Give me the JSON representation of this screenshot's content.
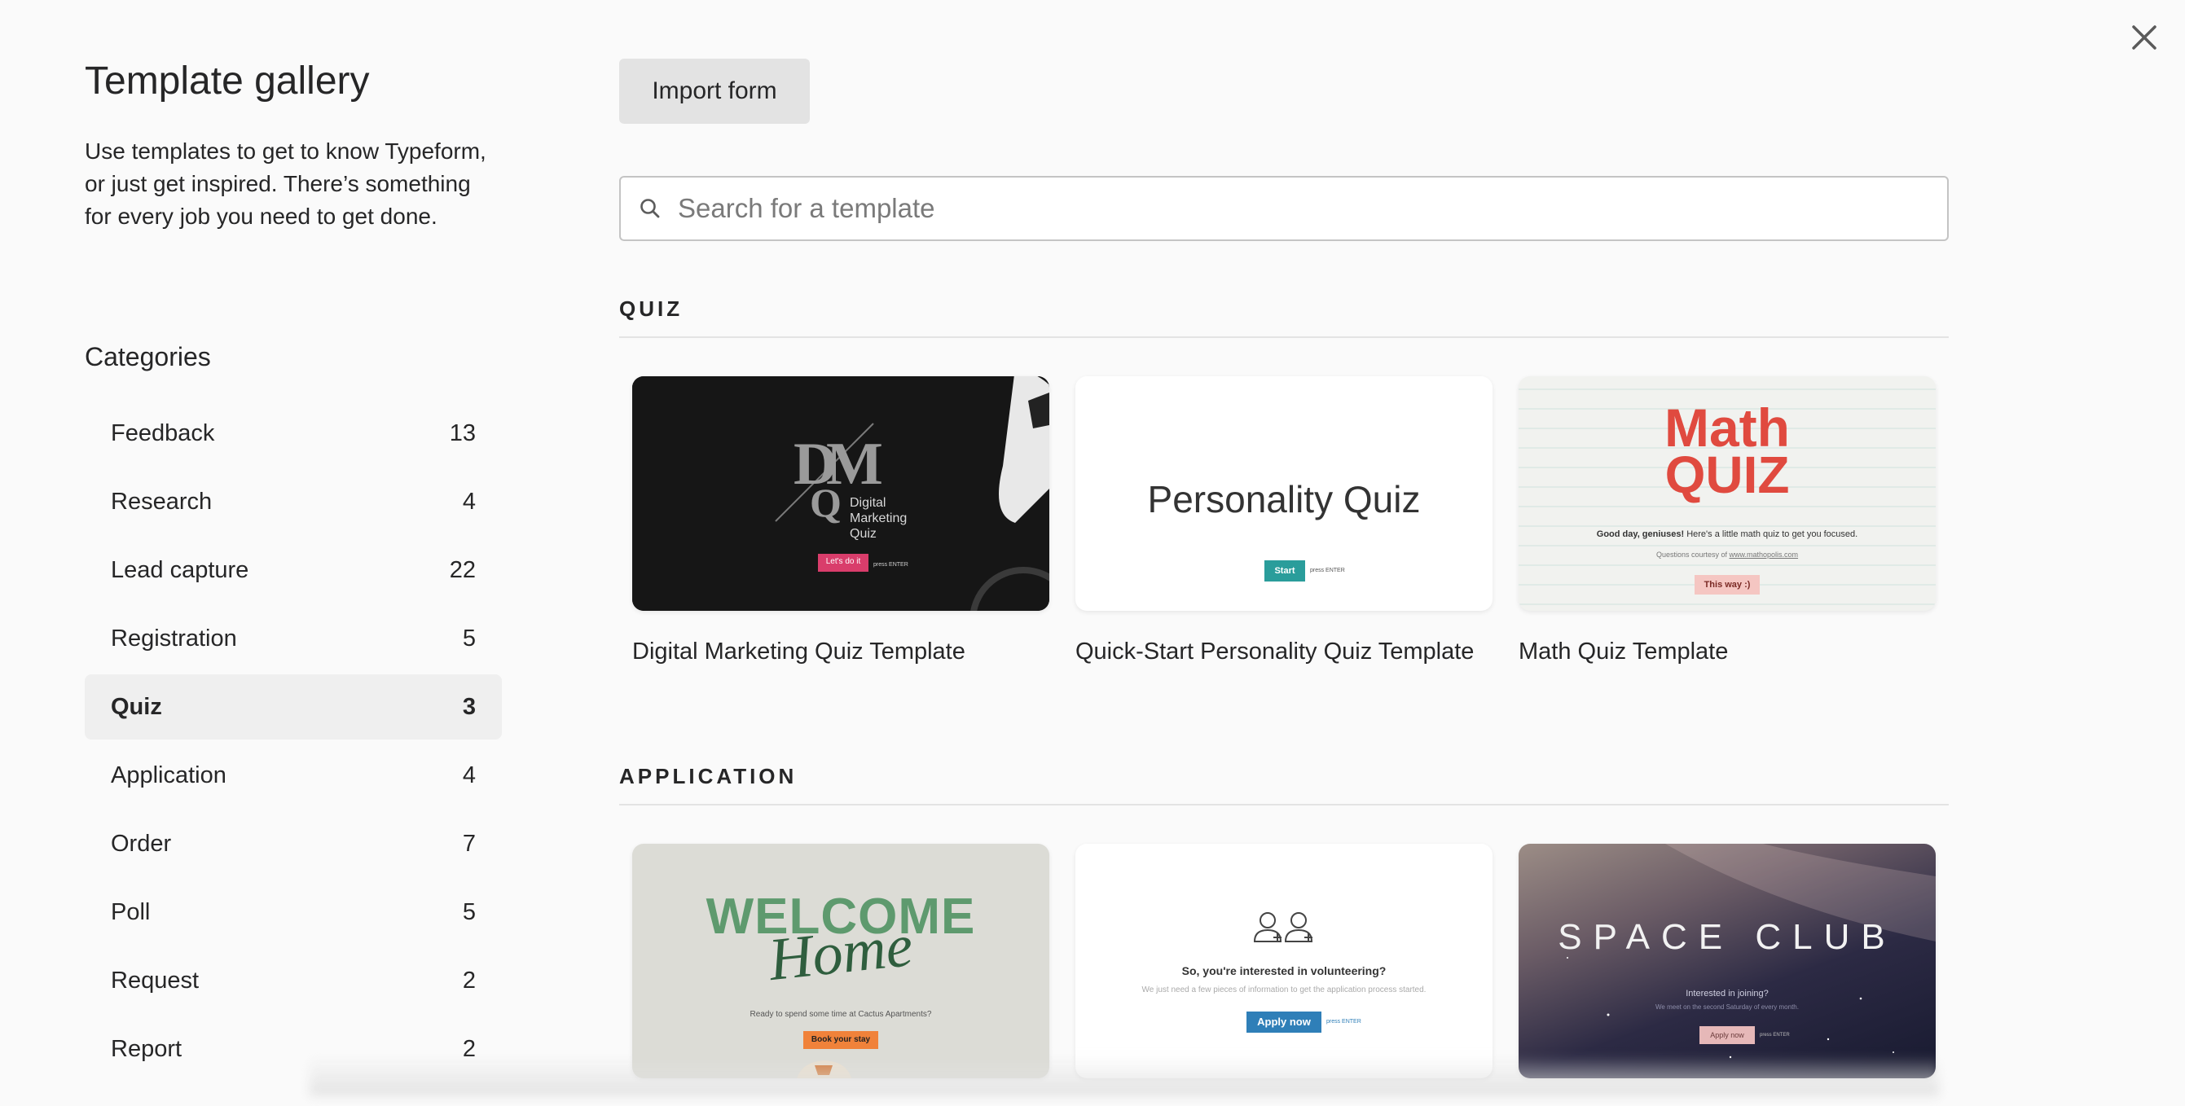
{
  "dialog": {
    "close_icon": "close-icon"
  },
  "sidebar": {
    "title": "Template gallery",
    "description": "Use templates to get to know Typeform, or just get inspired. There’s something for every job you need to get done.",
    "categories_heading": "Categories",
    "categories": [
      {
        "label": "Feedback",
        "count": "13"
      },
      {
        "label": "Research",
        "count": "4"
      },
      {
        "label": "Lead capture",
        "count": "22"
      },
      {
        "label": "Registration",
        "count": "5"
      },
      {
        "label": "Quiz",
        "count": "3",
        "active": true
      },
      {
        "label": "Application",
        "count": "4"
      },
      {
        "label": "Order",
        "count": "7"
      },
      {
        "label": "Poll",
        "count": "5"
      },
      {
        "label": "Request",
        "count": "2"
      },
      {
        "label": "Report",
        "count": "2"
      }
    ]
  },
  "main": {
    "import_button": "Import form",
    "search": {
      "placeholder": "Search for a template",
      "icon": "search-icon"
    },
    "sections": [
      {
        "heading": "QUIZ",
        "templates": [
          {
            "title": "Digital Marketing Quiz Template",
            "thumb": {
              "logo": "DM Q",
              "text_line1": "Digital",
              "text_line2": "Marketing",
              "text_line3": "Quiz",
              "button": "Let's do it",
              "hint": "press ENTER",
              "bg": "#1a1a1a",
              "accent": "#d93d6b"
            }
          },
          {
            "title": "Quick-Start Personality Quiz Template",
            "thumb": {
              "heading": "Personality Quiz",
              "button": "Start",
              "hint": "press ENTER",
              "accent": "#2a9d9b"
            }
          },
          {
            "title": "Math Quiz Template",
            "thumb": {
              "heading_line1": "Math",
              "heading_line2": "QUIZ",
              "greeting_bold": "Good day, geniuses!",
              "greeting_rest": " Here's a little math quiz to get you focused.",
              "credit_prefix": "Questions courtesy of ",
              "credit_link": "www.mathopolis.com",
              "button": "This way :)",
              "hint": "press ENTER",
              "accent": "#e04a3f"
            }
          }
        ]
      },
      {
        "heading": "APPLICATION",
        "templates": [
          {
            "title": "",
            "thumb": {
              "heading": "WELCOME",
              "script": "Home",
              "subtitle": "Ready to spend some time at Cactus Apartments?",
              "button": "Book your stay",
              "accent": "#f0823a"
            }
          },
          {
            "title": "",
            "thumb": {
              "heading": "So, you're interested in volunteering?",
              "subtitle": "We just need a few pieces of information to get the application process started.",
              "button": "Apply now",
              "hint": "press ENTER",
              "accent": "#2f7fb8"
            }
          },
          {
            "title": "",
            "thumb": {
              "heading": "SPACE CLUB",
              "subtitle": "Interested in joining?",
              "subtitle2": "We meet on the second Saturday of every month.",
              "button": "Apply now",
              "hint": "press ENTER"
            }
          }
        ]
      }
    ]
  }
}
